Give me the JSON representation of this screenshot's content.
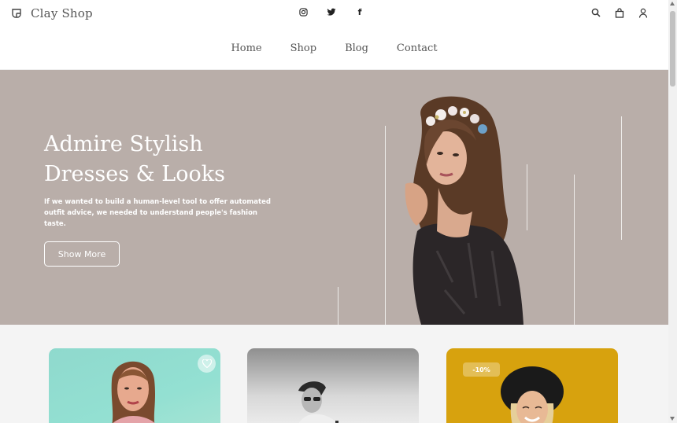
{
  "brand": {
    "name": "Clay Shop"
  },
  "header": {
    "social": [
      {
        "icon": "instagram-icon"
      },
      {
        "icon": "twitter-icon"
      },
      {
        "icon": "facebook-icon",
        "glyph": "f"
      }
    ],
    "actions": [
      {
        "icon": "search-icon"
      },
      {
        "icon": "bag-icon"
      },
      {
        "icon": "user-icon"
      }
    ]
  },
  "nav": {
    "items": [
      {
        "label": "Home"
      },
      {
        "label": "Shop"
      },
      {
        "label": "Blog"
      },
      {
        "label": "Contact"
      }
    ]
  },
  "hero": {
    "title": "Admire Stylish Dresses & Looks",
    "description": "If we wanted to build a human-level tool to offer automated outfit advice, we needed to understand people's fashion taste.",
    "button_label": "Show More",
    "background_color": "#b9aea9"
  },
  "products": [
    {
      "favorite_icon": "heart-icon",
      "background": "#93e0d2"
    },
    {
      "background": "#cfcfcf"
    },
    {
      "badge": "-10%",
      "background": "#d7a20e"
    }
  ]
}
